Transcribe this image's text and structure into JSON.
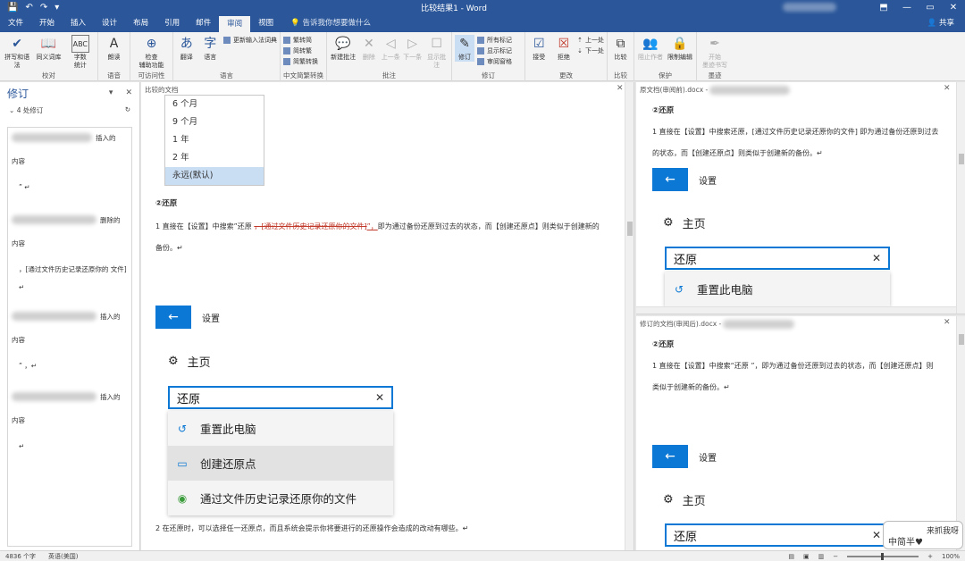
{
  "titlebar": {
    "title": "比较结果1 - Word",
    "qat": [
      "save-icon",
      "undo-icon",
      "redo-icon",
      "customize-icon"
    ],
    "min": "—",
    "restore": "▭",
    "close": "✕",
    "ribbon_toggle": "⬒"
  },
  "tabs": {
    "items": [
      "文件",
      "开始",
      "插入",
      "设计",
      "布局",
      "引用",
      "邮件",
      "审阅",
      "视图"
    ],
    "active": "审阅",
    "tell_me": "告诉我你想要做什么",
    "share": "共享"
  },
  "ribbon": {
    "proofing": {
      "label": "校对",
      "spell": "拼写和语法",
      "thesaurus": "同义词库",
      "wordcount_l1": "字数",
      "wordcount_l2": "统计"
    },
    "voice": {
      "label": "语音",
      "read": "朗读"
    },
    "access": {
      "label": "可访问性",
      "check_l1": "检查",
      "check_l2": "辅助功能"
    },
    "language": {
      "label": "语言",
      "translate": "翻译",
      "language": "语言",
      "ime": "更新输入法词典"
    },
    "chinese": {
      "label": "中文简繁转换",
      "t2s": "繁转简",
      "s2t": "简转繁",
      "convert": "简繁转换"
    },
    "comments": {
      "label": "批注",
      "new": "新建批注",
      "delete": "删除",
      "prev": "上一条",
      "next": "下一条",
      "show": "显示批注"
    },
    "tracking": {
      "label": "修订",
      "track": "修订",
      "all_markup": "所有标记",
      "show_markup": "显示标记",
      "pane": "审阅窗格"
    },
    "changes": {
      "label": "更改",
      "accept": "接受",
      "reject": "拒绝",
      "prev": "上一处",
      "next": "下一处"
    },
    "compare": {
      "label": "比较",
      "compare": "比较"
    },
    "protect": {
      "label": "保护",
      "block": "阻止作者",
      "restrict": "限制编辑"
    },
    "ink": {
      "label": "墨迹",
      "start_l1": "开始",
      "start_l2": "墨迹书写"
    }
  },
  "revisions_pane": {
    "title": "修订",
    "count": "4 处修订",
    "items": [
      {
        "action": "插入的",
        "type": "内容",
        "text": "” ↵"
      },
      {
        "action": "删除的",
        "type": "内容",
        "text": "，[通过文件历史记录还原你的 文件] ↵"
      },
      {
        "action": "插入的",
        "type": "内容",
        "text": "” ，↵"
      },
      {
        "action": "插入的",
        "type": "内容",
        "text": "↵"
      }
    ]
  },
  "compared_doc": {
    "label": "比较的文档",
    "dropdown": [
      "6 个月",
      "9 个月",
      "1 年",
      "2 年",
      "永远(默认)"
    ],
    "dropdown_selected": "永远(默认)",
    "heading": "②还原",
    "para1_a": "1 直接在【设置】中搜索”还原 ",
    "para1_del": "，[通过文件历史记录还原你的文件]",
    "para1_ins": "”，",
    "para1_b": "即为通过备份还原到过去的状态，而【创建还原点】则类似于创建新的",
    "para1_c": "备份。↵",
    "settings_label": "设置",
    "home_label": "主页",
    "search_value": "还原",
    "suggestions": [
      "重置此电脑",
      "创建还原点",
      "通过文件历史记录还原你的文件"
    ],
    "para2": "2 在还原时，可以选择任一还原点，而且系统会提示你将要进行的还原操作会造成的改动有哪些。↵"
  },
  "original_doc": {
    "label": "原文档(审阅前).docx - ",
    "heading": "②还原",
    "para_a": "1 直接在【设置】中搜索还原，[通过文件历史记录还原你的文件] 即为通过备份还原到过去",
    "para_b": "的状态，而【创建还原点】则类似于创建新的备份。↵",
    "settings_label": "设置",
    "home_label": "主页",
    "search_value": "还原",
    "suggestion": "重置此电脑"
  },
  "revised_doc": {
    "label": "修订的文档(审阅后).docx - ",
    "heading": "②还原",
    "para_a": "1 直接在【设置】中搜索“还原 ”，即为通过备份还原到过去的状态，而【创建还原点】则",
    "para_b": "类似于创建新的备份。↵",
    "settings_label": "设置",
    "home_label": "主页",
    "search_value": "还原"
  },
  "statusbar": {
    "words": "4836 个字",
    "language": "英语(美国)",
    "zoom": "100%"
  },
  "watermark": {
    "line1": "来抓我呀",
    "line2": "中简半♥"
  }
}
